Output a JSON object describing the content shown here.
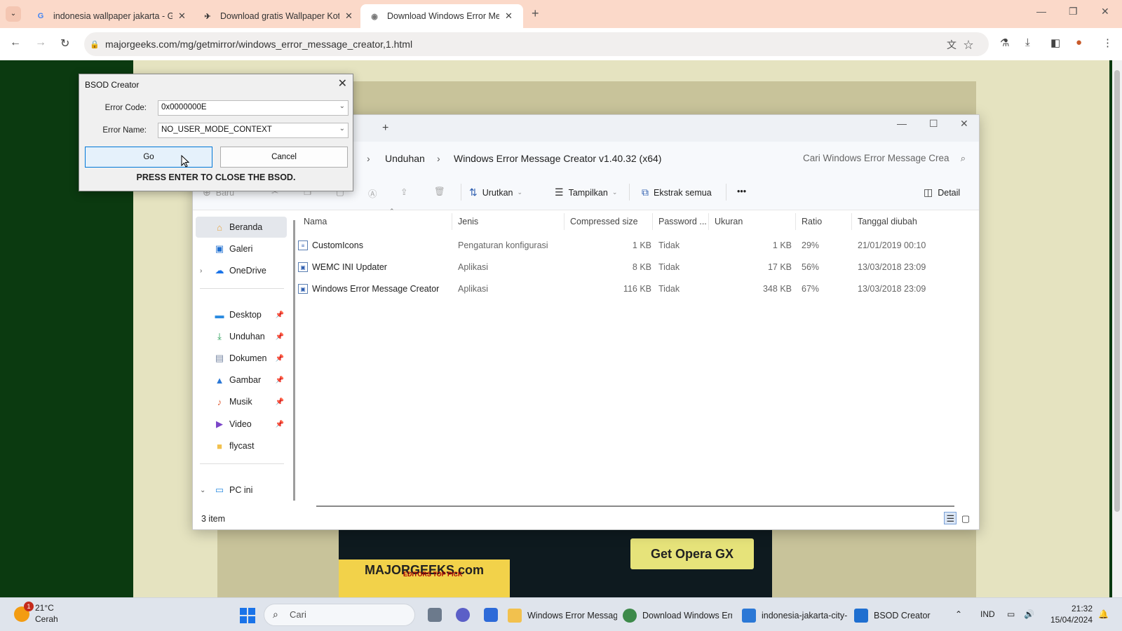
{
  "browser": {
    "tabs": [
      {
        "title": "indonesia wallpaper jakarta - Google",
        "fav": "G",
        "active": false
      },
      {
        "title": "Download gratis Wallpaper Kota",
        "fav": "✈",
        "active": false
      },
      {
        "title": "Download Windows Error Message",
        "fav": "◉",
        "active": true
      }
    ],
    "url": "majorgeeks.com/mg/getmirror/windows_error_message_creator,1.html"
  },
  "ad": {
    "logo": "MAJORGEEKS.com",
    "logo_sub": "EDITORS TOP PICK",
    "cta": "Get Opera GX"
  },
  "explorer": {
    "breadcrumb": [
      "Unduhan",
      "Windows Error Message Creator v1.40.32 (x64)"
    ],
    "search_placeholder": "Cari Windows Error Message Crea",
    "commands": {
      "new": "Baru",
      "sort": "Urutkan",
      "view": "Tampilkan",
      "extract": "Ekstrak semua",
      "more": "•••",
      "details": "Detail"
    },
    "nav": [
      {
        "label": "Beranda",
        "icon": "home-icon",
        "glyph": "⌂",
        "color": "#e8a33a",
        "selected": true
      },
      {
        "label": "Galeri",
        "icon": "gallery-icon",
        "glyph": "▣",
        "color": "#1f6fd0"
      },
      {
        "label": "OneDrive",
        "icon": "cloud-icon",
        "glyph": "☁",
        "color": "#1a73e8",
        "chev": true
      },
      {
        "label": "Desktop",
        "icon": "desktop-icon",
        "glyph": "▬",
        "color": "#2b8be0",
        "pin": true
      },
      {
        "label": "Unduhan",
        "icon": "download-icon",
        "glyph": "⤓",
        "color": "#1f9a4f",
        "pin": true
      },
      {
        "label": "Dokumen",
        "icon": "document-icon",
        "glyph": "▤",
        "color": "#7a8aa6",
        "pin": true
      },
      {
        "label": "Gambar",
        "icon": "pictures-icon",
        "glyph": "▲",
        "color": "#2b78d6",
        "pin": true
      },
      {
        "label": "Musik",
        "icon": "music-icon",
        "glyph": "♪",
        "color": "#e0603a",
        "pin": true
      },
      {
        "label": "Video",
        "icon": "video-icon",
        "glyph": "▶",
        "color": "#7b45c8",
        "pin": true
      },
      {
        "label": "flycast",
        "icon": "folder-icon",
        "glyph": "■",
        "color": "#f2c14e"
      },
      {
        "label": "PC ini",
        "icon": "pc-icon",
        "glyph": "▭",
        "color": "#2b8be0",
        "chev": true
      }
    ],
    "columns": [
      "Nama",
      "Jenis",
      "Compressed size",
      "Password ...",
      "Ukuran",
      "Ratio",
      "Tanggal diubah"
    ],
    "rows": [
      {
        "name": "CustomIcons",
        "type": "Pengaturan konfigurasi",
        "compressed": "1 KB",
        "password": "Tidak",
        "size": "1 KB",
        "ratio": "29%",
        "date": "21/01/2019 00:10"
      },
      {
        "name": "WEMC INI Updater",
        "type": "Aplikasi",
        "compressed": "8 KB",
        "password": "Tidak",
        "size": "17 KB",
        "ratio": "56%",
        "date": "13/03/2018 23:09"
      },
      {
        "name": "Windows Error Message Creator",
        "type": "Aplikasi",
        "compressed": "116 KB",
        "password": "Tidak",
        "size": "348 KB",
        "ratio": "67%",
        "date": "13/03/2018 23:09"
      }
    ],
    "status": "3 item"
  },
  "dialog": {
    "title": "BSOD Creator",
    "error_code_label": "Error Code:",
    "error_code_value": "0x0000000E",
    "error_name_label": "Error Name:",
    "error_name_value": "NO_USER_MODE_CONTEXT",
    "go": "Go",
    "cancel": "Cancel",
    "message": "PRESS ENTER TO CLOSE THE BSOD."
  },
  "taskbar": {
    "weather_temp": "21°C",
    "weather_desc": "Cerah",
    "weather_badge": "1",
    "search_placeholder": "Cari",
    "apps": [
      "Windows Error Message",
      "Download Windows Err",
      "indonesia-jakarta-city-",
      "BSOD Creator"
    ],
    "lang": "IND",
    "time": "21:32",
    "date": "15/04/2024"
  }
}
